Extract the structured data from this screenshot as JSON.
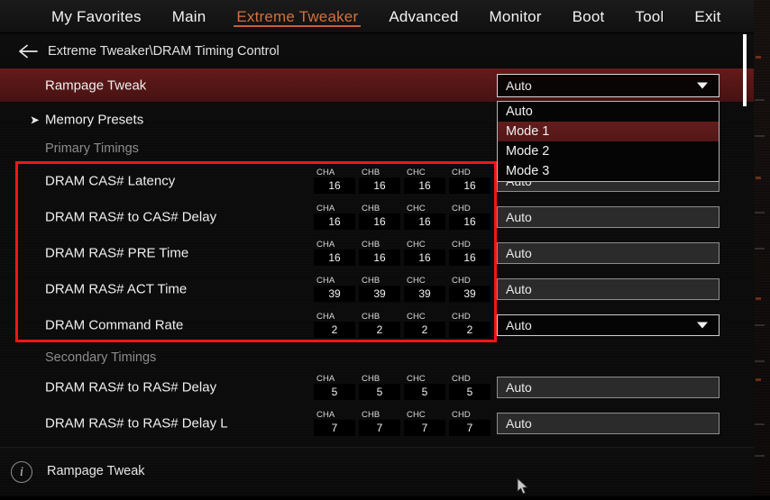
{
  "menu": {
    "items": [
      {
        "label": "My Favorites",
        "active": false
      },
      {
        "label": "Main",
        "active": false
      },
      {
        "label": "Extreme Tweaker",
        "active": true
      },
      {
        "label": "Advanced",
        "active": false
      },
      {
        "label": "Monitor",
        "active": false
      },
      {
        "label": "Boot",
        "active": false
      },
      {
        "label": "Tool",
        "active": false
      },
      {
        "label": "Exit",
        "active": false
      }
    ],
    "accent_color": "#d4703c"
  },
  "breadcrumb": {
    "back_icon": "arrow-left-icon",
    "text": "Extreme Tweaker\\DRAM Timing Control"
  },
  "rows": [
    {
      "type": "setting",
      "label": "Rampage Tweak",
      "highlighted": true,
      "value": "Auto",
      "control": "dropdown-open",
      "channels": null
    },
    {
      "type": "submenu",
      "label": "Memory Presets",
      "arrow": "➤",
      "highlighted": false,
      "value": null,
      "control": "none",
      "channels": null
    },
    {
      "type": "section",
      "label": "Primary Timings",
      "highlighted": false,
      "value": null,
      "control": "none",
      "channels": null
    },
    {
      "type": "setting",
      "label": "DRAM CAS# Latency",
      "highlighted": false,
      "value": "Auto",
      "control": "textbox",
      "channels": [
        {
          "name": "CHA",
          "value": "16"
        },
        {
          "name": "CHB",
          "value": "16"
        },
        {
          "name": "CHC",
          "value": "16"
        },
        {
          "name": "CHD",
          "value": "16"
        }
      ]
    },
    {
      "type": "setting",
      "label": "DRAM RAS# to CAS# Delay",
      "highlighted": false,
      "value": "Auto",
      "control": "textbox",
      "channels": [
        {
          "name": "CHA",
          "value": "16"
        },
        {
          "name": "CHB",
          "value": "16"
        },
        {
          "name": "CHC",
          "value": "16"
        },
        {
          "name": "CHD",
          "value": "16"
        }
      ]
    },
    {
      "type": "setting",
      "label": "DRAM RAS# PRE Time",
      "highlighted": false,
      "value": "Auto",
      "control": "textbox",
      "channels": [
        {
          "name": "CHA",
          "value": "16"
        },
        {
          "name": "CHB",
          "value": "16"
        },
        {
          "name": "CHC",
          "value": "16"
        },
        {
          "name": "CHD",
          "value": "16"
        }
      ]
    },
    {
      "type": "setting",
      "label": "DRAM RAS# ACT Time",
      "highlighted": false,
      "value": "Auto",
      "control": "textbox",
      "channels": [
        {
          "name": "CHA",
          "value": "39"
        },
        {
          "name": "CHB",
          "value": "39"
        },
        {
          "name": "CHC",
          "value": "39"
        },
        {
          "name": "CHD",
          "value": "39"
        }
      ]
    },
    {
      "type": "setting",
      "label": "DRAM Command Rate",
      "highlighted": false,
      "value": "Auto",
      "control": "dropdown-focused",
      "channels": [
        {
          "name": "CHA",
          "value": "2"
        },
        {
          "name": "CHB",
          "value": "2"
        },
        {
          "name": "CHC",
          "value": "2"
        },
        {
          "name": "CHD",
          "value": "2"
        }
      ]
    },
    {
      "type": "section",
      "label": "Secondary Timings",
      "highlighted": false,
      "value": null,
      "control": "none",
      "channels": null
    },
    {
      "type": "setting",
      "label": "DRAM RAS# to RAS# Delay",
      "highlighted": false,
      "value": "Auto",
      "control": "textbox",
      "channels": [
        {
          "name": "CHA",
          "value": "5"
        },
        {
          "name": "CHB",
          "value": "5"
        },
        {
          "name": "CHC",
          "value": "5"
        },
        {
          "name": "CHD",
          "value": "5"
        }
      ]
    },
    {
      "type": "setting",
      "label": "DRAM RAS# to RAS# Delay L",
      "highlighted": false,
      "value": "Auto",
      "control": "textbox",
      "channels": [
        {
          "name": "CHA",
          "value": "7"
        },
        {
          "name": "CHB",
          "value": "7"
        },
        {
          "name": "CHC",
          "value": "7"
        },
        {
          "name": "CHD",
          "value": "7"
        }
      ]
    }
  ],
  "dropdown": {
    "owner_label": "Rampage Tweak",
    "options": [
      {
        "label": "Auto",
        "selected": false
      },
      {
        "label": "Mode 1",
        "selected": true
      },
      {
        "label": "Mode 2",
        "selected": false
      },
      {
        "label": "Mode 3",
        "selected": false
      }
    ],
    "highlight_color": "#5a1818"
  },
  "annotation": {
    "name": "red-highlight-box",
    "color": "#f21616"
  },
  "statusbar": {
    "icon": "info-icon",
    "icon_glyph": "i",
    "text": "Rampage Tweak"
  },
  "scrollbar": {
    "thumb_color": "#ffffff"
  },
  "cursor": {
    "name": "mouse-pointer"
  }
}
